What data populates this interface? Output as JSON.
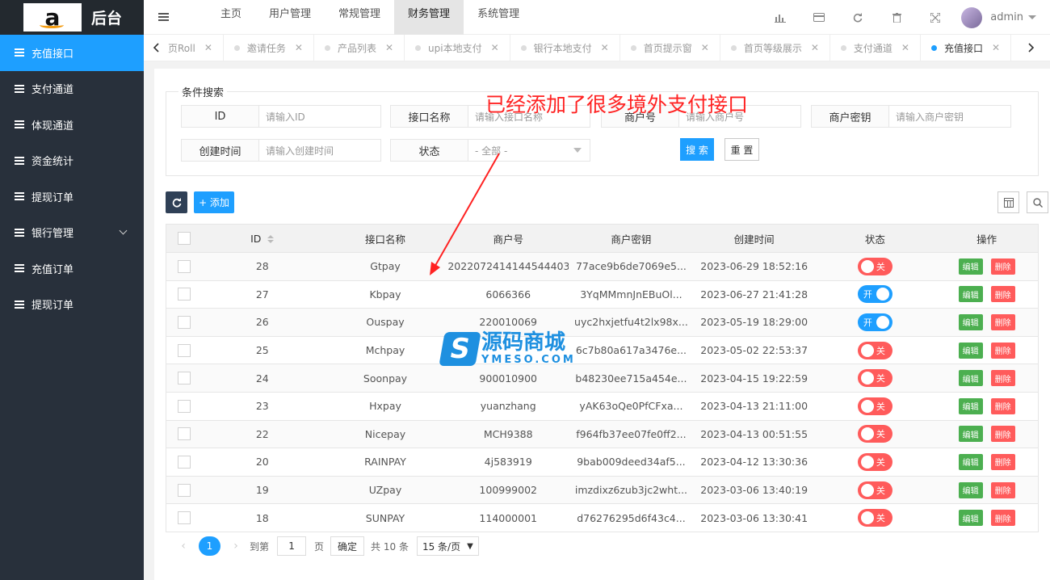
{
  "app": {
    "logo_letter": "a",
    "title": "后台"
  },
  "sidebar": {
    "items": [
      {
        "label": "充值接口",
        "active": true
      },
      {
        "label": "支付通道"
      },
      {
        "label": "体现通道"
      },
      {
        "label": "资金统计"
      },
      {
        "label": "提现订单"
      },
      {
        "label": "银行管理",
        "has_children": true
      },
      {
        "label": "充值订单"
      },
      {
        "label": "提现订单"
      }
    ]
  },
  "topnav": {
    "items": [
      "主页",
      "用户管理",
      "常规管理",
      "财务管理",
      "系统管理"
    ],
    "active": "财务管理"
  },
  "topright": {
    "user": "admin",
    "icons": [
      "chart-icon",
      "card-icon",
      "refresh-icon",
      "trash-icon",
      "fullscreen-icon"
    ]
  },
  "tabs": {
    "items": [
      "页Roll",
      "邀请任务",
      "产品列表",
      "upi本地支付",
      "银行本地支付",
      "首页提示窗",
      "首页等级展示",
      "支付通道",
      "充值接口"
    ],
    "active": "充值接口"
  },
  "search": {
    "legend": "条件搜索",
    "fields": [
      {
        "label": "ID",
        "placeholder": "请输入ID"
      },
      {
        "label": "接口名称",
        "placeholder": "请输入接口名称"
      },
      {
        "label": "商户号",
        "placeholder": "请输入商户号"
      },
      {
        "label": "商户密钥",
        "placeholder": "请输入商户密钥"
      },
      {
        "label": "创建时间",
        "placeholder": "请输入创建时间"
      },
      {
        "label": "状态",
        "placeholder": "- 全部 -"
      }
    ],
    "search_label": "搜 索",
    "reset_label": "重 置"
  },
  "annotation": "已经添加了很多境外支付接口",
  "toolbar": {
    "add_label": "+ 添加"
  },
  "table": {
    "headers": [
      "ID",
      "接口名称",
      "商户号",
      "商户密钥",
      "创建时间",
      "状态",
      "操作"
    ],
    "rows": [
      {
        "id": "28",
        "name": "Gtpay",
        "merchant": "2022072414144544403",
        "key": "77ace9b6de7069e5...",
        "created": "2023-06-29 18:52:16",
        "status": "关"
      },
      {
        "id": "27",
        "name": "Kbpay",
        "merchant": "6066366",
        "key": "3YqMMmnJnEBuOl...",
        "created": "2023-06-27 21:41:28",
        "status": "开"
      },
      {
        "id": "26",
        "name": "Ouspay",
        "merchant": "220010069",
        "key": "uyc2hxjetfu4t2lx98x...",
        "created": "2023-05-19 18:29:00",
        "status": "开"
      },
      {
        "id": "25",
        "name": "Mchpay",
        "merchant": "",
        "key": "6c7b80a617a3476e...",
        "created": "2023-05-02 22:53:37",
        "status": "关"
      },
      {
        "id": "24",
        "name": "Soonpay",
        "merchant": "900010900",
        "key": "b48230ee715a454e...",
        "created": "2023-04-15 19:22:59",
        "status": "关"
      },
      {
        "id": "23",
        "name": "Hxpay",
        "merchant": "yuanzhang",
        "key": "yAK63oQe0PfCFxa...",
        "created": "2023-04-13 21:11:00",
        "status": "关"
      },
      {
        "id": "22",
        "name": "Nicepay",
        "merchant": "MCH9388",
        "key": "f964fb37ee07fe0ff2...",
        "created": "2023-04-13 00:51:55",
        "status": "关"
      },
      {
        "id": "20",
        "name": "RAINPAY",
        "merchant": "4j583919",
        "key": "9bab009deed34af5...",
        "created": "2023-04-12 13:30:36",
        "status": "关"
      },
      {
        "id": "19",
        "name": "UZpay",
        "merchant": "100999002",
        "key": "imzdixz6zub3jc2wht...",
        "created": "2023-03-06 13:40:19",
        "status": "关"
      },
      {
        "id": "18",
        "name": "SUNPAY",
        "merchant": "114000001",
        "key": "d76276295d6f43c4...",
        "created": "2023-03-06 13:30:41",
        "status": "关"
      }
    ],
    "edit_label": "编辑",
    "delete_label": "删除"
  },
  "pager": {
    "current": "1",
    "goto_label": "到第",
    "page_input": "1",
    "page_unit": "页",
    "confirm_label": "确定",
    "total": "共 10 条",
    "page_size": "15 条/页"
  },
  "watermark": {
    "logo": "S",
    "cn": "源码商城",
    "en": "YMESO.COM"
  }
}
